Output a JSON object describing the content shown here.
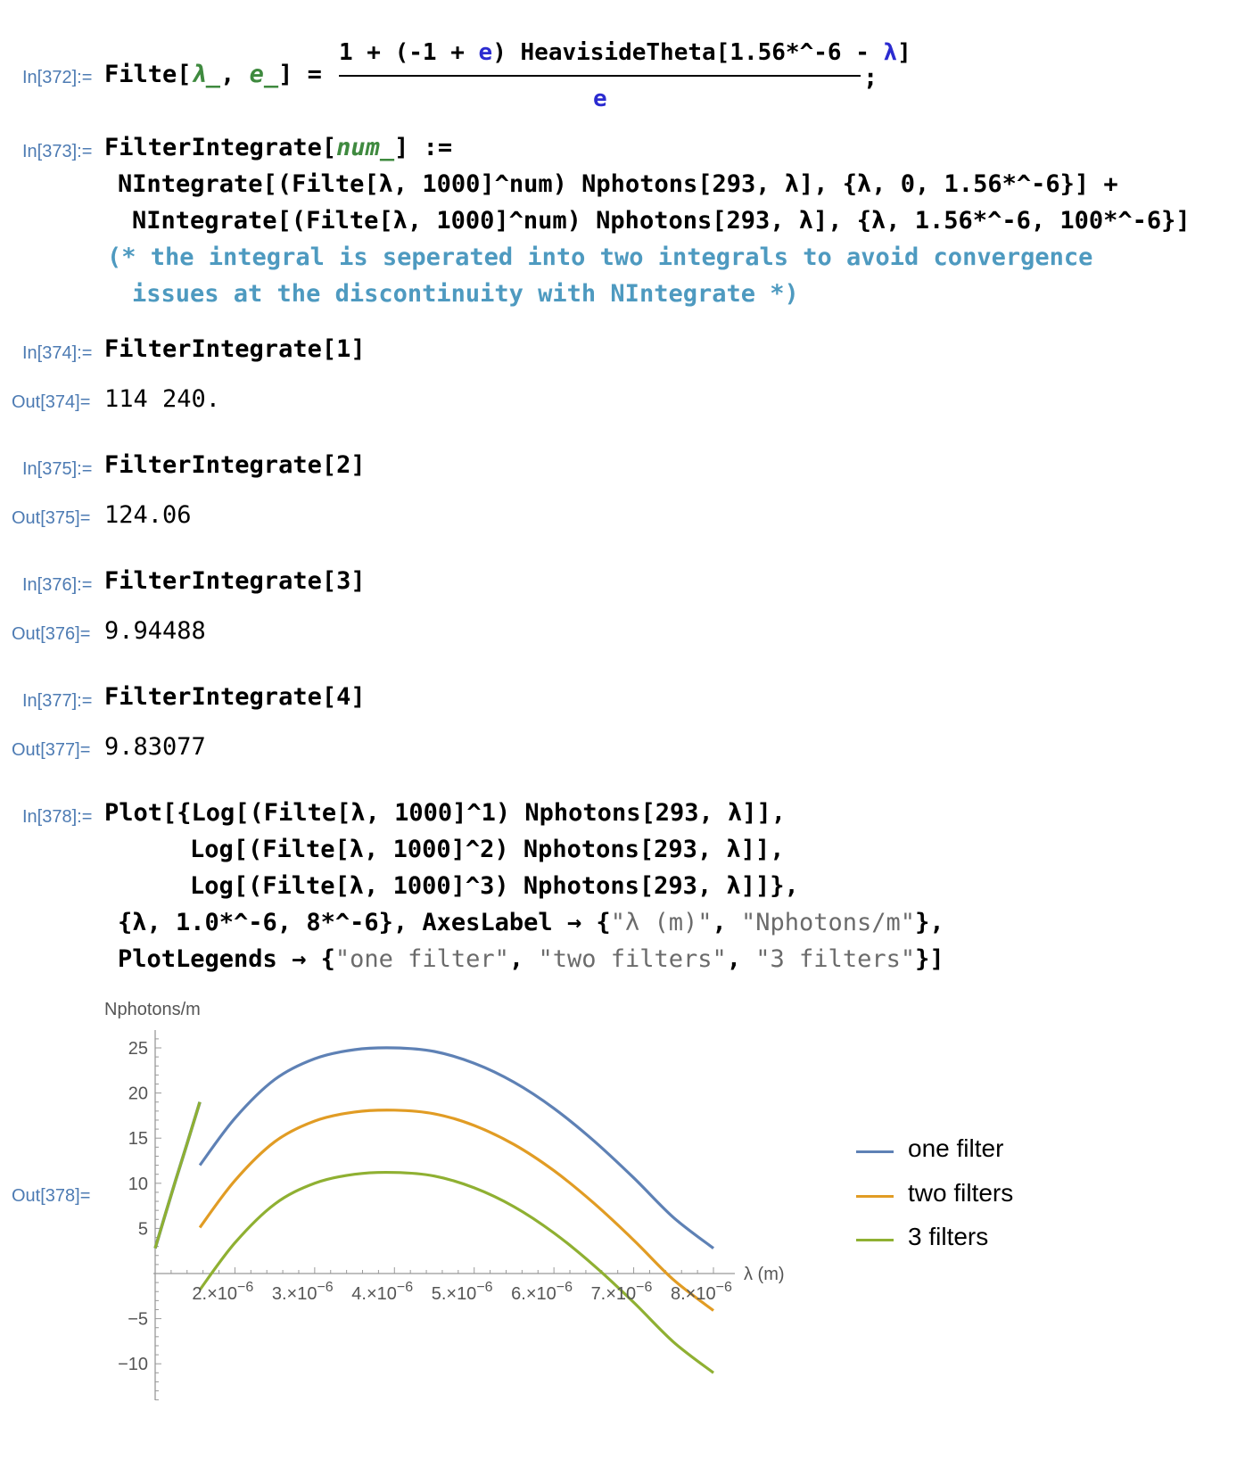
{
  "cells": {
    "c372": {
      "in_label": "In[372]:=",
      "lhs": "Filte[",
      "lam_arg": "λ_",
      "comma": ", ",
      "e_arg": "e_",
      "close_eq": "] =",
      "num_a": "1 + (-1 + ",
      "num_e": "e",
      "num_b": ") HeavisideTheta[1.56*^-6 - ",
      "num_lam": "λ",
      "num_c": "]",
      "den": "e",
      "semicolon": ";"
    },
    "c373": {
      "in_label": "In[373]:=",
      "line1a": "FilterIntegrate[",
      "line1b": "num_",
      "line1c": "] :=",
      "line2": "NIntegrate[(Filte[λ, 1000]^num) Nphotons[293, λ], {λ, 0, 1.56*^-6}] +",
      "line3": "NIntegrate[(Filte[λ, 1000]^num) Nphotons[293, λ], {λ, 1.56*^-6, 100*^-6}]",
      "comment1": "(* the integral is seperated into two integrals to avoid convergence",
      "comment2": "issues at the discontinuity with NIntegrate *)"
    },
    "c374": {
      "in_label": "In[374]:=",
      "input": "FilterIntegrate[1]",
      "out_label": "Out[374]=",
      "output": "114 240."
    },
    "c375": {
      "in_label": "In[375]:=",
      "input": "FilterIntegrate[2]",
      "out_label": "Out[375]=",
      "output": "124.06"
    },
    "c376": {
      "in_label": "In[376]:=",
      "input": "FilterIntegrate[3]",
      "out_label": "Out[376]=",
      "output": "9.94488"
    },
    "c377": {
      "in_label": "In[377]:=",
      "input": "FilterIntegrate[4]",
      "out_label": "Out[377]=",
      "output": "9.83077"
    },
    "c378": {
      "in_label": "In[378]:=",
      "line1": "Plot[{Log[(Filte[λ, 1000]^1) Nphotons[293, λ]],",
      "line2": "Log[(Filte[λ, 1000]^2) Nphotons[293, λ]],",
      "line3": "Log[(Filte[λ, 1000]^3) Nphotons[293, λ]]},",
      "line4a": "{λ, 1.0*^-6, 8*^-6}, AxesLabel → {",
      "line4b": "\"λ (m)\"",
      "line4c": ", ",
      "line4d": "\"Nphotons/m\"",
      "line4e": "},",
      "line5a": "PlotLegends → {",
      "line5b": "\"one filter\"",
      "line5c": ", ",
      "line5d": "\"two filters\"",
      "line5e": ", ",
      "line5f": "\"3 filters\"",
      "line5g": "}]",
      "out_label": "Out[378]="
    }
  },
  "chart_data": {
    "type": "line",
    "xlabel": "λ (m)",
    "ylabel": "Nphotons/m",
    "xlim": [
      1e-06,
      8e-06
    ],
    "ylim": [
      -12,
      27
    ],
    "x_ticks": [
      2e-06,
      3e-06,
      4e-06,
      5e-06,
      6e-06,
      7e-06,
      8e-06
    ],
    "x_tick_labels": [
      {
        "mant": "2.",
        "exp": "-6"
      },
      {
        "mant": "3.",
        "exp": "-6"
      },
      {
        "mant": "4.",
        "exp": "-6"
      },
      {
        "mant": "5.",
        "exp": "-6"
      },
      {
        "mant": "6.",
        "exp": "-6"
      },
      {
        "mant": "7.",
        "exp": "-6"
      },
      {
        "mant": "8.",
        "exp": "-6"
      }
    ],
    "y_ticks": [
      -10,
      -5,
      5,
      10,
      15,
      20,
      25
    ],
    "legend_placement": "right",
    "series": [
      {
        "name": "one filter",
        "color": "#5e81b5",
        "points": [
          [
            1.56e-06,
            12.0
          ],
          [
            2e-06,
            17.2
          ],
          [
            2.5e-06,
            21.5
          ],
          [
            3e-06,
            23.8
          ],
          [
            3.5e-06,
            24.8
          ],
          [
            4e-06,
            25.0
          ],
          [
            4.5e-06,
            24.6
          ],
          [
            5e-06,
            23.3
          ],
          [
            5.5e-06,
            21.2
          ],
          [
            6e-06,
            18.3
          ],
          [
            6.5e-06,
            14.7
          ],
          [
            7e-06,
            10.6
          ],
          [
            7.5e-06,
            6.2
          ],
          [
            8e-06,
            2.8
          ]
        ]
      },
      {
        "name": "two filters",
        "color": "#e19c24",
        "points": [
          [
            1.56e-06,
            5.1
          ],
          [
            2e-06,
            10.3
          ],
          [
            2.5e-06,
            14.6
          ],
          [
            3e-06,
            16.9
          ],
          [
            3.5e-06,
            17.9
          ],
          [
            4e-06,
            18.1
          ],
          [
            4.5e-06,
            17.7
          ],
          [
            5e-06,
            16.4
          ],
          [
            5.5e-06,
            14.3
          ],
          [
            6e-06,
            11.4
          ],
          [
            6.5e-06,
            7.8
          ],
          [
            7e-06,
            3.7
          ],
          [
            7.5e-06,
            -0.7
          ],
          [
            8e-06,
            -4.1
          ]
        ]
      },
      {
        "name": "3 filters",
        "color": "#8fb032",
        "points": [
          [
            1.56e-06,
            -1.8
          ],
          [
            2e-06,
            3.4
          ],
          [
            2.5e-06,
            7.7
          ],
          [
            3e-06,
            10.0
          ],
          [
            3.5e-06,
            11.0
          ],
          [
            4e-06,
            11.2
          ],
          [
            4.5e-06,
            10.8
          ],
          [
            5e-06,
            9.5
          ],
          [
            5.5e-06,
            7.4
          ],
          [
            6e-06,
            4.5
          ],
          [
            6.5e-06,
            0.9
          ],
          [
            7e-06,
            -3.2
          ],
          [
            7.5e-06,
            -7.6
          ],
          [
            8e-06,
            -11.0
          ]
        ]
      }
    ],
    "shared_segment": {
      "color": "#8fb032",
      "points": [
        [
          1e-06,
          2.8
        ],
        [
          1.2e-06,
          8.7
        ],
        [
          1.4e-06,
          14.4
        ],
        [
          1.56e-06,
          19.0
        ]
      ]
    }
  }
}
